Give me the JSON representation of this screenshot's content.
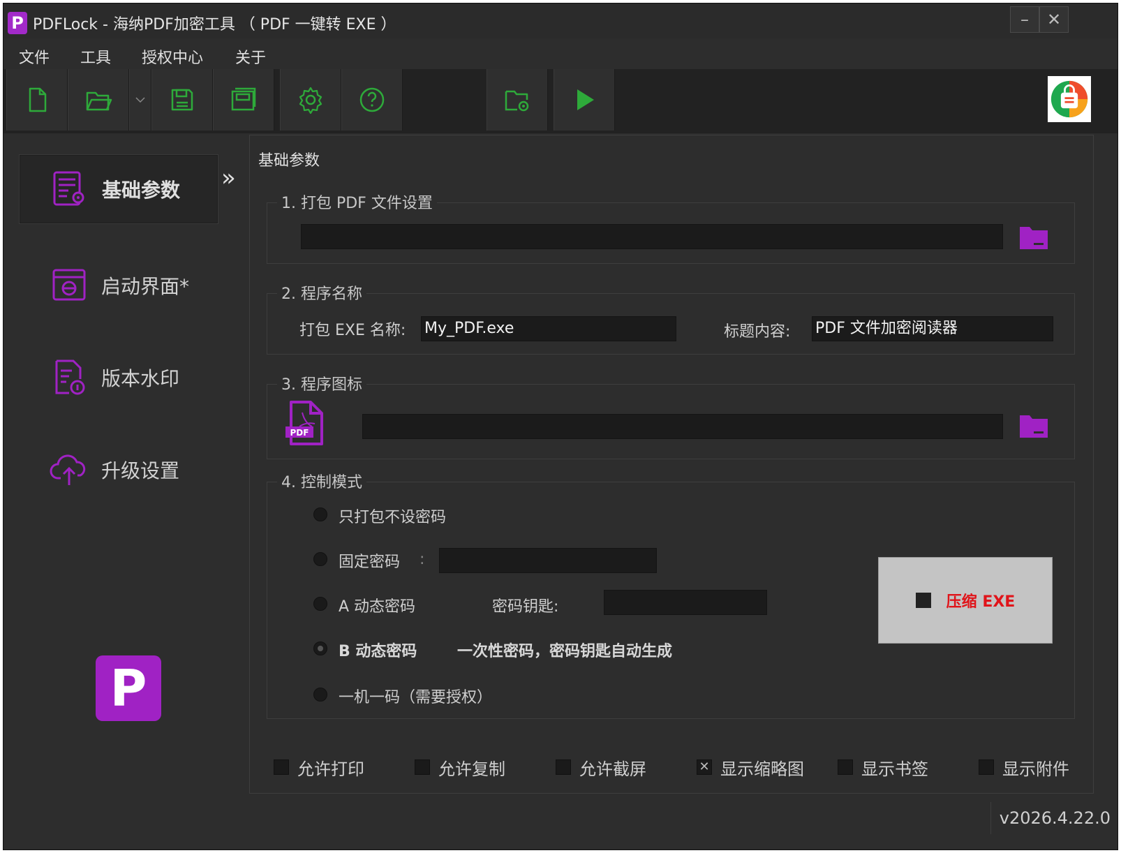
{
  "titlebar": {
    "logo_letter": "P",
    "title": "PDFLock - 海纳PDF加密工具 （ PDF 一键转 EXE ）",
    "minimize": "–",
    "close": "✕"
  },
  "menu": [
    "文件",
    "工具",
    "授权中心",
    "关于"
  ],
  "toolbar": {
    "icons": [
      "new-file-icon",
      "open-folder-icon",
      "dropdown-icon",
      "save-icon",
      "save-as-icon",
      "settings-icon",
      "help-icon",
      "build-folder-icon",
      "run-icon"
    ]
  },
  "sidebar": {
    "items": [
      {
        "label": "基础参数",
        "icon": "parameters-icon",
        "active": true
      },
      {
        "label": "启动界面*",
        "icon": "splash-screen-icon",
        "active": false
      },
      {
        "label": "版本水印",
        "icon": "watermark-icon",
        "active": false
      },
      {
        "label": "升级设置",
        "icon": "upgrade-cloud-icon",
        "active": false
      }
    ],
    "logo_letter": "P"
  },
  "panel": {
    "title": "基础参数",
    "group1": {
      "legend": "1. 打包 PDF 文件设置",
      "path": ""
    },
    "group2": {
      "legend": "2. 程序名称",
      "exe_label": "打包 EXE 名称:",
      "exe_value": "My_PDF.exe",
      "title_label": "标题内容:",
      "title_value": "PDF 文件加密阅读器"
    },
    "group3": {
      "legend": "3. 程序图标",
      "icon_path": "",
      "pdf_badge": "PDF"
    },
    "group4": {
      "legend": "4. 控制模式",
      "options": [
        {
          "label": "只打包不设密码",
          "selected": false
        },
        {
          "label": "固定密码",
          "selected": false
        },
        {
          "label": "A 动态密码",
          "selected": false
        },
        {
          "label": "B 动态密码",
          "selected": true
        },
        {
          "label": "一机一码（需要授权）",
          "selected": false
        }
      ],
      "fixed_sep": ":",
      "key_label": "密码钥匙:",
      "b_desc": "一次性密码，密码钥匙自动生成",
      "compress_label": "压缩 EXE"
    },
    "checkboxes": [
      {
        "label": "允许打印",
        "checked": false
      },
      {
        "label": "允许复制",
        "checked": false
      },
      {
        "label": "允许截屏",
        "checked": false
      },
      {
        "label": "显示缩略图",
        "checked": true
      },
      {
        "label": "显示书签",
        "checked": false
      },
      {
        "label": "显示附件",
        "checked": false
      }
    ]
  },
  "status": {
    "version": "v2026.4.22.0"
  },
  "colors": {
    "accent_purple": "#a022c4",
    "toolbar_green": "#2eaa3a",
    "compress_red": "#e0141a"
  }
}
